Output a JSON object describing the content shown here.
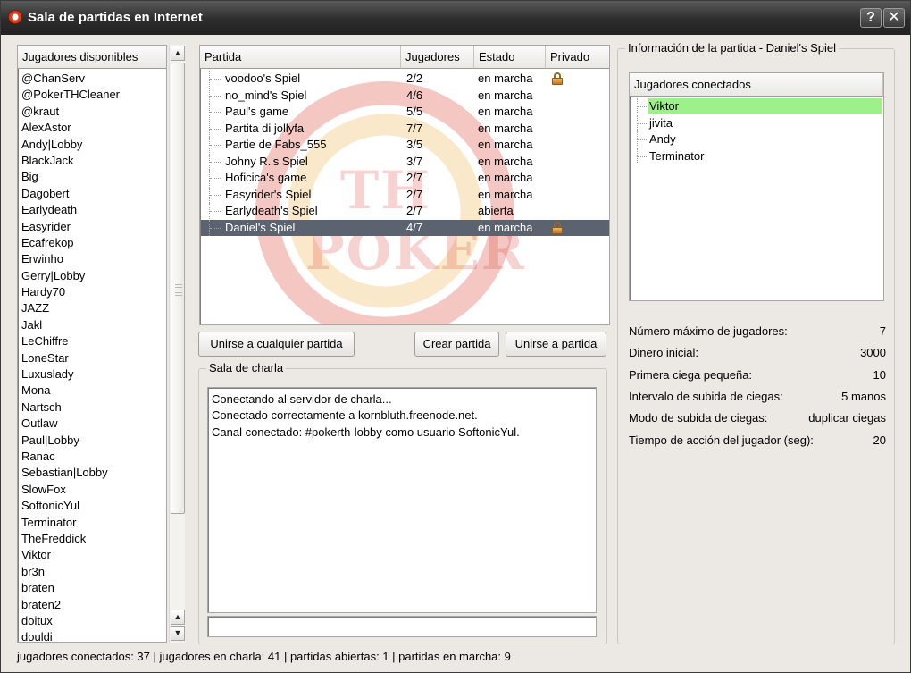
{
  "window": {
    "title": "Sala de partidas en Internet",
    "help_label": "?",
    "close_label": "✕"
  },
  "players": {
    "header": "Jugadores disponibles",
    "items": [
      "@ChanServ",
      "@PokerTHCleaner",
      "@kraut",
      "AlexAstor",
      "Andy|Lobby",
      "BlackJack",
      "Big",
      "Dagobert",
      "Earlydeath",
      "Easyrider",
      "Ecafrekop",
      "Erwinho",
      "Gerry|Lobby",
      "Hardy70",
      "JAZZ",
      "Jakl",
      "LeChiffre",
      "LoneStar",
      "Luxuslady",
      "Mona",
      "Nartsch",
      "Outlaw",
      "Paul|Lobby",
      "Ranac",
      "Sebastian|Lobby",
      "SlowFox",
      "SoftonicYul",
      "Terminator",
      "TheFreddick",
      "Viktor",
      "br3n",
      "braten",
      "braten2",
      "doitux",
      "douldi"
    ]
  },
  "games": {
    "columns": [
      "Partida",
      "Jugadores",
      "Estado",
      "Privado"
    ],
    "rows": [
      {
        "name": "voodoo's Spiel",
        "players": "2/2",
        "status": "en marcha",
        "private": true
      },
      {
        "name": "no_mind's Spiel",
        "players": "4/6",
        "status": "en marcha",
        "private": false
      },
      {
        "name": "Paul's game",
        "players": "5/5",
        "status": "en marcha",
        "private": false
      },
      {
        "name": "Partita di jollyfa",
        "players": "7/7",
        "status": "en marcha",
        "private": false
      },
      {
        "name": "Partie de Fabs_555",
        "players": "3/5",
        "status": "en marcha",
        "private": false
      },
      {
        "name": "Johny R.'s Spiel",
        "players": "3/7",
        "status": "en marcha",
        "private": false
      },
      {
        "name": "Hoficica's game",
        "players": "2/7",
        "status": "en marcha",
        "private": false
      },
      {
        "name": "Easyrider's Spiel",
        "players": "2/7",
        "status": "en marcha",
        "private": false
      },
      {
        "name": "Earlydeath's Spiel",
        "players": "2/7",
        "status": "abierta",
        "private": false
      },
      {
        "name": "Daniel's Spiel",
        "players": "4/7",
        "status": "en marcha",
        "private": true
      }
    ],
    "selected_index": 9,
    "watermark": "TH POKER"
  },
  "buttons": {
    "join_any": "Unirse a cualquier partida",
    "create": "Crear partida",
    "join": "Unirse a partida"
  },
  "chat": {
    "title": "Sala de charla",
    "lines": [
      "Conectando al servidor de charla...",
      "Conectado correctamente a kornbluth.freenode.net.",
      "Canal conectado: #pokerth-lobby como usuario SoftonicYul."
    ],
    "input_value": ""
  },
  "game_info": {
    "title": "Información de la partida - Daniel's Spiel",
    "connected_header": "Jugadores conectados",
    "connected_players": [
      "Viktor",
      "jivita",
      "Andy",
      "Terminator"
    ],
    "highlight_index": 0,
    "details": [
      {
        "label": "Número máximo de jugadores:",
        "value": "7"
      },
      {
        "label": "Dinero inicial:",
        "value": "3000"
      },
      {
        "label": "Primera ciega pequeña:",
        "value": "10"
      },
      {
        "label": "Intervalo de subida de ciegas:",
        "value": "5 manos"
      },
      {
        "label": "Modo de subida de ciegas:",
        "value": "duplicar ciegas"
      },
      {
        "label": "Tiempo de acción del jugador (seg):",
        "value": "20"
      }
    ]
  },
  "status": {
    "text": "jugadores conectados: 37  | jugadores en charla: 41  | partidas abiertas: 1  | partidas en marcha: 9"
  }
}
